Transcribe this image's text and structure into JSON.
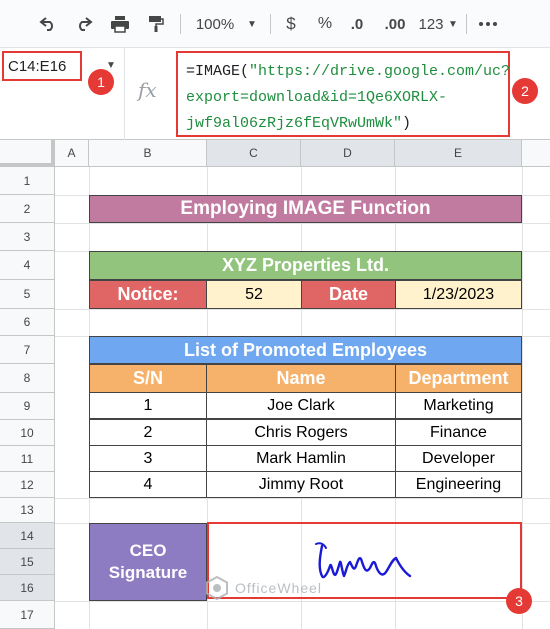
{
  "toolbar": {
    "zoom": "100%",
    "currency": "$",
    "percent": "%",
    "dec_decrease": ".0",
    "dec_increase": ".00",
    "format_more": "123",
    "more": "⋮"
  },
  "formula_bar": {
    "name_box": "C14:E16",
    "fx": "fx",
    "formula_prefix": "=IMAGE(",
    "formula_url": "\"https://drive.google.com/uc?export=download&id=1Qe6XORLX-jwf9al06zRjz6fEqVRwUmWk\"",
    "formula_suffix": ")"
  },
  "badges": [
    "1",
    "2",
    "3"
  ],
  "columns": [
    "A",
    "B",
    "C",
    "D",
    "E"
  ],
  "rows": [
    "1",
    "2",
    "3",
    "4",
    "5",
    "6",
    "7",
    "8",
    "9",
    "10",
    "11",
    "12",
    "13",
    "14",
    "15",
    "16",
    "17"
  ],
  "sheet": {
    "title": "Employing IMAGE Function",
    "company": "XYZ Properties Ltd.",
    "notice_label": "Notice:",
    "notice_value": "52",
    "date_label": "Date",
    "date_value": "1/23/2023",
    "list_title": "List of Promoted Employees",
    "headers": [
      "S/N",
      "Name",
      "Department"
    ],
    "employees": [
      {
        "sn": "1",
        "name": "Joe Clark",
        "dept": "Marketing"
      },
      {
        "sn": "2",
        "name": "Chris Rogers",
        "dept": "Finance"
      },
      {
        "sn": "3",
        "name": "Mark Hamlin",
        "dept": "Developer"
      },
      {
        "sn": "4",
        "name": "Jimmy Root",
        "dept": "Engineering"
      }
    ],
    "ceo_line1": "CEO",
    "ceo_line2": "Signature"
  },
  "watermark": "OfficeWheel",
  "colors": {
    "title": "#c27ba0",
    "green": "#93c47d",
    "red": "#e06666",
    "cream": "#fff2cc",
    "blue": "#6fa8f0",
    "orange": "#f6b26b",
    "purple": "#8e7cc3",
    "highlight": "#e53935"
  }
}
